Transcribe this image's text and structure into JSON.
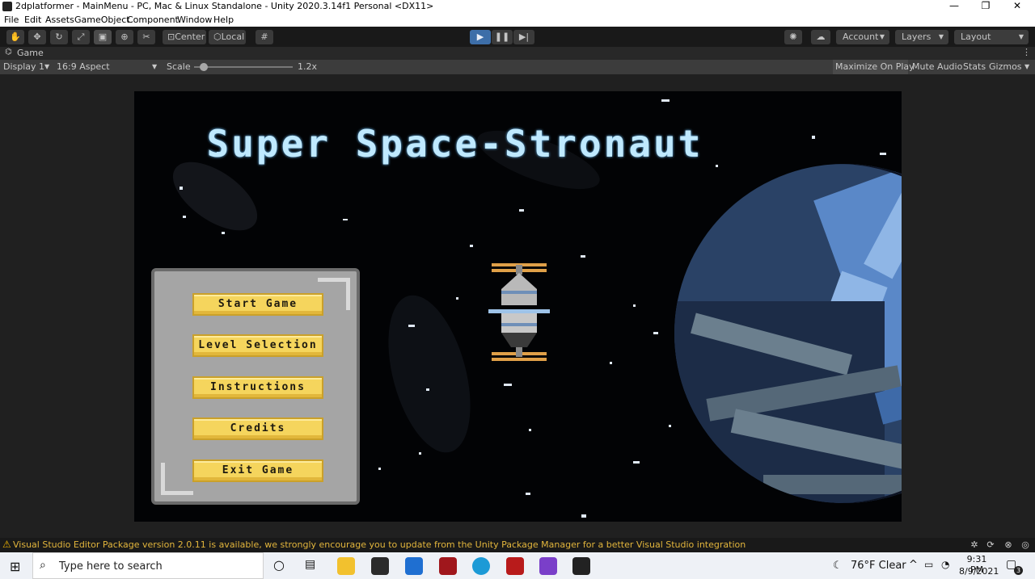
{
  "window": {
    "title": "2dplatformer - MainMenu - PC, Mac & Linux Standalone - Unity 2020.3.14f1 Personal <DX11>",
    "controls": [
      "—",
      "❐",
      "✕"
    ]
  },
  "menubar": [
    "File",
    "Edit",
    "Assets",
    "GameObject",
    "Component",
    "Window",
    "Help"
  ],
  "toolbar": {
    "pivot": "Center",
    "space": "Local",
    "account": "Account",
    "layers": "Layers",
    "layout": "Layout"
  },
  "game_tab": {
    "label": "Game"
  },
  "game_toolbar": {
    "display": "Display 1",
    "aspect": "16:9 Aspect",
    "scale_label": "Scale",
    "scale_value": "1.2x",
    "scale_fraction": 0.06,
    "maximize": "Maximize On Play",
    "mute": "Mute Audio",
    "stats": "Stats",
    "gizmos": "Gizmos"
  },
  "game": {
    "title": "Super Space-Stronaut",
    "menu_buttons": [
      "Start Game",
      "Level Selection",
      "Instructions",
      "Credits",
      "Exit Game"
    ]
  },
  "status": {
    "message": "Visual Studio Editor Package version 2.0.11 is available, we strongly encourage you to update from the Unity Package Manager for a better Visual Studio integration"
  },
  "taskbar": {
    "search_placeholder": "Type here to search",
    "weather": "76°F  Clear",
    "time": "9:31 PM",
    "date": "8/9/2021",
    "notification_count": "3"
  },
  "colors": {
    "accent_play": "#3d6ea8",
    "button_gold": "#f5d55d",
    "title_text": "#bfe9ff",
    "warning": "#e2b53c"
  }
}
